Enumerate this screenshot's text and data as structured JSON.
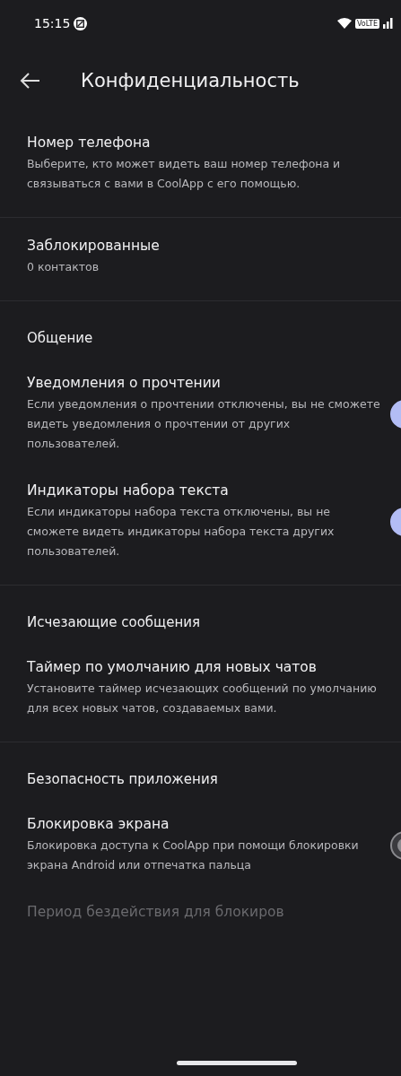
{
  "status_bar": {
    "time": "15:15",
    "network": "VoLTE"
  },
  "header": {
    "title": "Конфиденциальность"
  },
  "sections": [
    {
      "items": [
        {
          "kind": "text",
          "title": "Номер телефона",
          "subtitle": "Выберите, кто может видеть ваш номер телефона и связываться с вами в CoolApp с его помощью."
        }
      ]
    },
    {
      "items": [
        {
          "kind": "text",
          "title": "Заблокированные",
          "subtitle": "0 контактов"
        }
      ]
    },
    {
      "header": "Общение",
      "items": [
        {
          "kind": "toggle",
          "title": "Уведомления о прочтении",
          "subtitle": "Если уведомления о прочтении отключены, вы не сможете видеть уведомления о прочтении от других пользователей.",
          "on": true
        },
        {
          "kind": "toggle",
          "title": "Индикаторы набора текста",
          "subtitle": "Если индикаторы набора текста отключены, вы не сможете видеть индикаторы набора текста других пользователей.",
          "on": true
        }
      ]
    },
    {
      "header": "Исчезающие сообщения",
      "items": [
        {
          "kind": "text",
          "title": "Таймер по умолчанию для новых чатов",
          "subtitle": "Установите таймер исчезающих сообщений по умолчанию для всех новых чатов, создаваемых вами."
        }
      ]
    },
    {
      "header": "Безопасность приложения",
      "items": [
        {
          "kind": "toggle",
          "title": "Блокировка экрана",
          "subtitle": "Блокировка доступа к CoolApp при помощи блокировки экрана Android или отпечатка пальца",
          "on": false
        },
        {
          "kind": "text",
          "title": "Период бездействия для блокиров",
          "disabled": true
        }
      ]
    }
  ]
}
